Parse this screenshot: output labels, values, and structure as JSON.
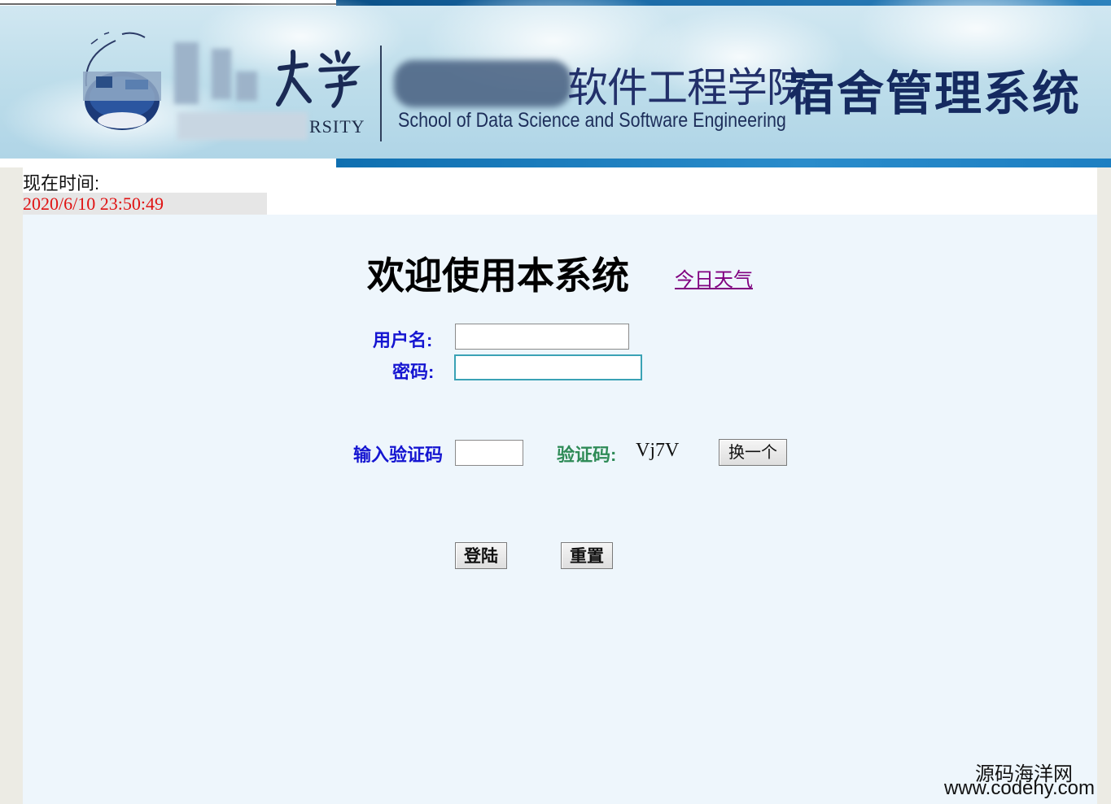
{
  "banner": {
    "rsity_text": "RSITY",
    "college_name_cn": "软件工程学院",
    "system_name": "宿舍管理系统",
    "college_name_en": "School of Data Science and Software Engineering"
  },
  "clock": {
    "label": "现在时间:",
    "value": "2020/6/10 23:50:49"
  },
  "login": {
    "welcome": "欢迎使用本系统",
    "weather_link": "今日天气",
    "username_label": "用户名:",
    "username_value": "",
    "password_label": "密码:",
    "password_value": "",
    "captcha_input_label": "输入验证码",
    "captcha_input_value": "",
    "captcha_label": "验证码:",
    "captcha_code": "Vj7V",
    "swap_button": "换一个",
    "login_button": "登陆",
    "reset_button": "重置"
  },
  "watermark": {
    "line1": "源码海洋网",
    "line2": "www.codehy.com"
  },
  "colors": {
    "label_blue": "#1515d1",
    "label_green": "#2e8b57",
    "time_red": "#e01212",
    "link_purple": "#800080",
    "panel_bg": "#eef6fc",
    "banner_blue": "#1a6aa6"
  }
}
